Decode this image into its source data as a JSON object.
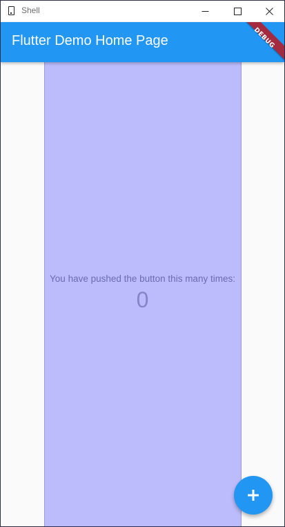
{
  "window": {
    "title": "Shell",
    "app_icon": "phone-icon",
    "controls": {
      "minimize_icon": "minimize-icon",
      "maximize_icon": "maximize-icon",
      "close_icon": "close-icon"
    }
  },
  "appbar": {
    "title": "Flutter Demo Home Page",
    "color": "#2196f3",
    "debug_banner": "DEBUG"
  },
  "main": {
    "counter_label": "You have pushed the button this many times:",
    "counter_value": "0"
  },
  "fab": {
    "icon": "add-icon",
    "color": "#2196f3"
  },
  "colors": {
    "overlay": "#bcbcfc",
    "debug_banner": "#a32a3f"
  }
}
